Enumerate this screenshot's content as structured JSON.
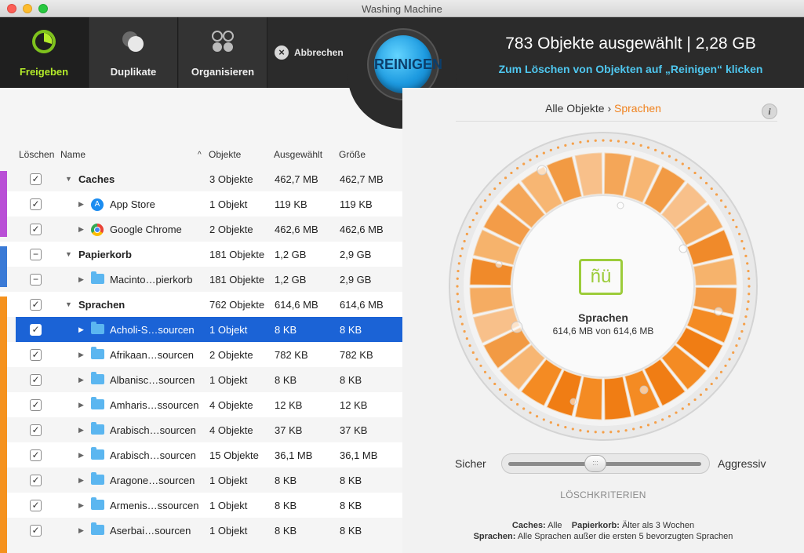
{
  "window": {
    "title": "Washing Machine"
  },
  "toolbar": {
    "freigeben": "Freigeben",
    "duplikate": "Duplikate",
    "organisieren": "Organisieren",
    "abbrechen": "Abbrechen",
    "clean_button": "REINIGEN",
    "summary_title": "783 Objekte ausgewählt | 2,28 GB",
    "summary_sub": "Zum Löschen von Objekten auf „Reinigen“ klicken"
  },
  "list": {
    "headers": {
      "delete": "Löschen",
      "name": "Name",
      "objects": "Objekte",
      "selected": "Ausgewählt",
      "size": "Größe"
    },
    "rows": [
      {
        "kind": "group",
        "check": "✓",
        "name": "Caches",
        "objects": "3 Objekte",
        "selected": "462,7 MB",
        "size": "462,7 MB"
      },
      {
        "kind": "item",
        "icon": "app-store-icon",
        "check": "✓",
        "name": "App Store",
        "objects": "1 Objekt",
        "selected": "119 KB",
        "size": "119 KB"
      },
      {
        "kind": "item",
        "icon": "chrome-icon",
        "check": "✓",
        "name": "Google Chrome",
        "objects": "2 Objekte",
        "selected": "462,6 MB",
        "size": "462,6 MB"
      },
      {
        "kind": "group",
        "check": "−",
        "name": "Papierkorb",
        "objects": "181 Objekte",
        "selected": "1,2 GB",
        "size": "2,9 GB"
      },
      {
        "kind": "item",
        "icon": "folder-icon",
        "check": "−",
        "name": "Macinto…pierkorb",
        "objects": "181 Objekte",
        "selected": "1,2 GB",
        "size": "2,9 GB"
      },
      {
        "kind": "group",
        "check": "✓",
        "name": "Sprachen",
        "objects": "762 Objekte",
        "selected": "614,6 MB",
        "size": "614,6 MB"
      },
      {
        "kind": "item",
        "icon": "folder-icon",
        "check": "✓",
        "name": "Acholi-S…sourcen",
        "objects": "1 Objekt",
        "selected": "8 KB",
        "size": "8 KB",
        "selected_row": true
      },
      {
        "kind": "item",
        "icon": "folder-icon",
        "check": "✓",
        "name": "Afrikaan…sourcen",
        "objects": "2 Objekte",
        "selected": "782 KB",
        "size": "782 KB"
      },
      {
        "kind": "item",
        "icon": "folder-icon",
        "check": "✓",
        "name": "Albanisc…sourcen",
        "objects": "1 Objekt",
        "selected": "8 KB",
        "size": "8 KB"
      },
      {
        "kind": "item",
        "icon": "folder-icon",
        "check": "✓",
        "name": "Amharis…ssourcen",
        "objects": "4 Objekte",
        "selected": "12 KB",
        "size": "12 KB"
      },
      {
        "kind": "item",
        "icon": "folder-icon",
        "check": "✓",
        "name": "Arabisch…sourcen",
        "objects": "4 Objekte",
        "selected": "37 KB",
        "size": "37 KB"
      },
      {
        "kind": "item",
        "icon": "folder-icon",
        "check": "✓",
        "name": "Arabisch…sourcen",
        "objects": "15 Objekte",
        "selected": "36,1 MB",
        "size": "36,1 MB"
      },
      {
        "kind": "item",
        "icon": "folder-icon",
        "check": "✓",
        "name": "Aragone…sourcen",
        "objects": "1 Objekt",
        "selected": "8 KB",
        "size": "8 KB"
      },
      {
        "kind": "item",
        "icon": "folder-icon",
        "check": "✓",
        "name": "Armenis…ssourcen",
        "objects": "1 Objekt",
        "selected": "8 KB",
        "size": "8 KB"
      },
      {
        "kind": "item",
        "icon": "folder-icon",
        "check": "✓",
        "name": "Aserbai…sourcen",
        "objects": "1 Objekt",
        "selected": "8 KB",
        "size": "8 KB"
      }
    ]
  },
  "right": {
    "crumb_root": "Alle Objekte",
    "crumb_sep": "›",
    "crumb_current": "Sprachen",
    "info": "i",
    "dial_icon_text": "ñü",
    "dial_title": "Sprachen",
    "dial_size": "614,6 MB von 614,6 MB",
    "slider_min": "Sicher",
    "slider_max": "Aggressiv",
    "slider_thumb": ":::",
    "slider_level": 0.45,
    "slider_caption": "LÖSCHKRITERIEN",
    "crit1_k1": "Caches:",
    "crit1_v1": "Alle",
    "crit1_k2": "Papierkorb:",
    "crit1_v2": "Älter als 3 Wochen",
    "crit2_k": "Sprachen:",
    "crit2_v": "Alle Sprachen außer die ersten 5 bevorzugten Sprachen"
  },
  "colors": {
    "accent_green": "#b4ec2a",
    "accent_blue": "#4fc7ef",
    "orange": "#f0821e",
    "selection": "#1b63d6",
    "caches_strip": "#b94fd6",
    "papierkorb_strip": "#3a7ad6",
    "sprachen_strip": "#f5921e"
  }
}
